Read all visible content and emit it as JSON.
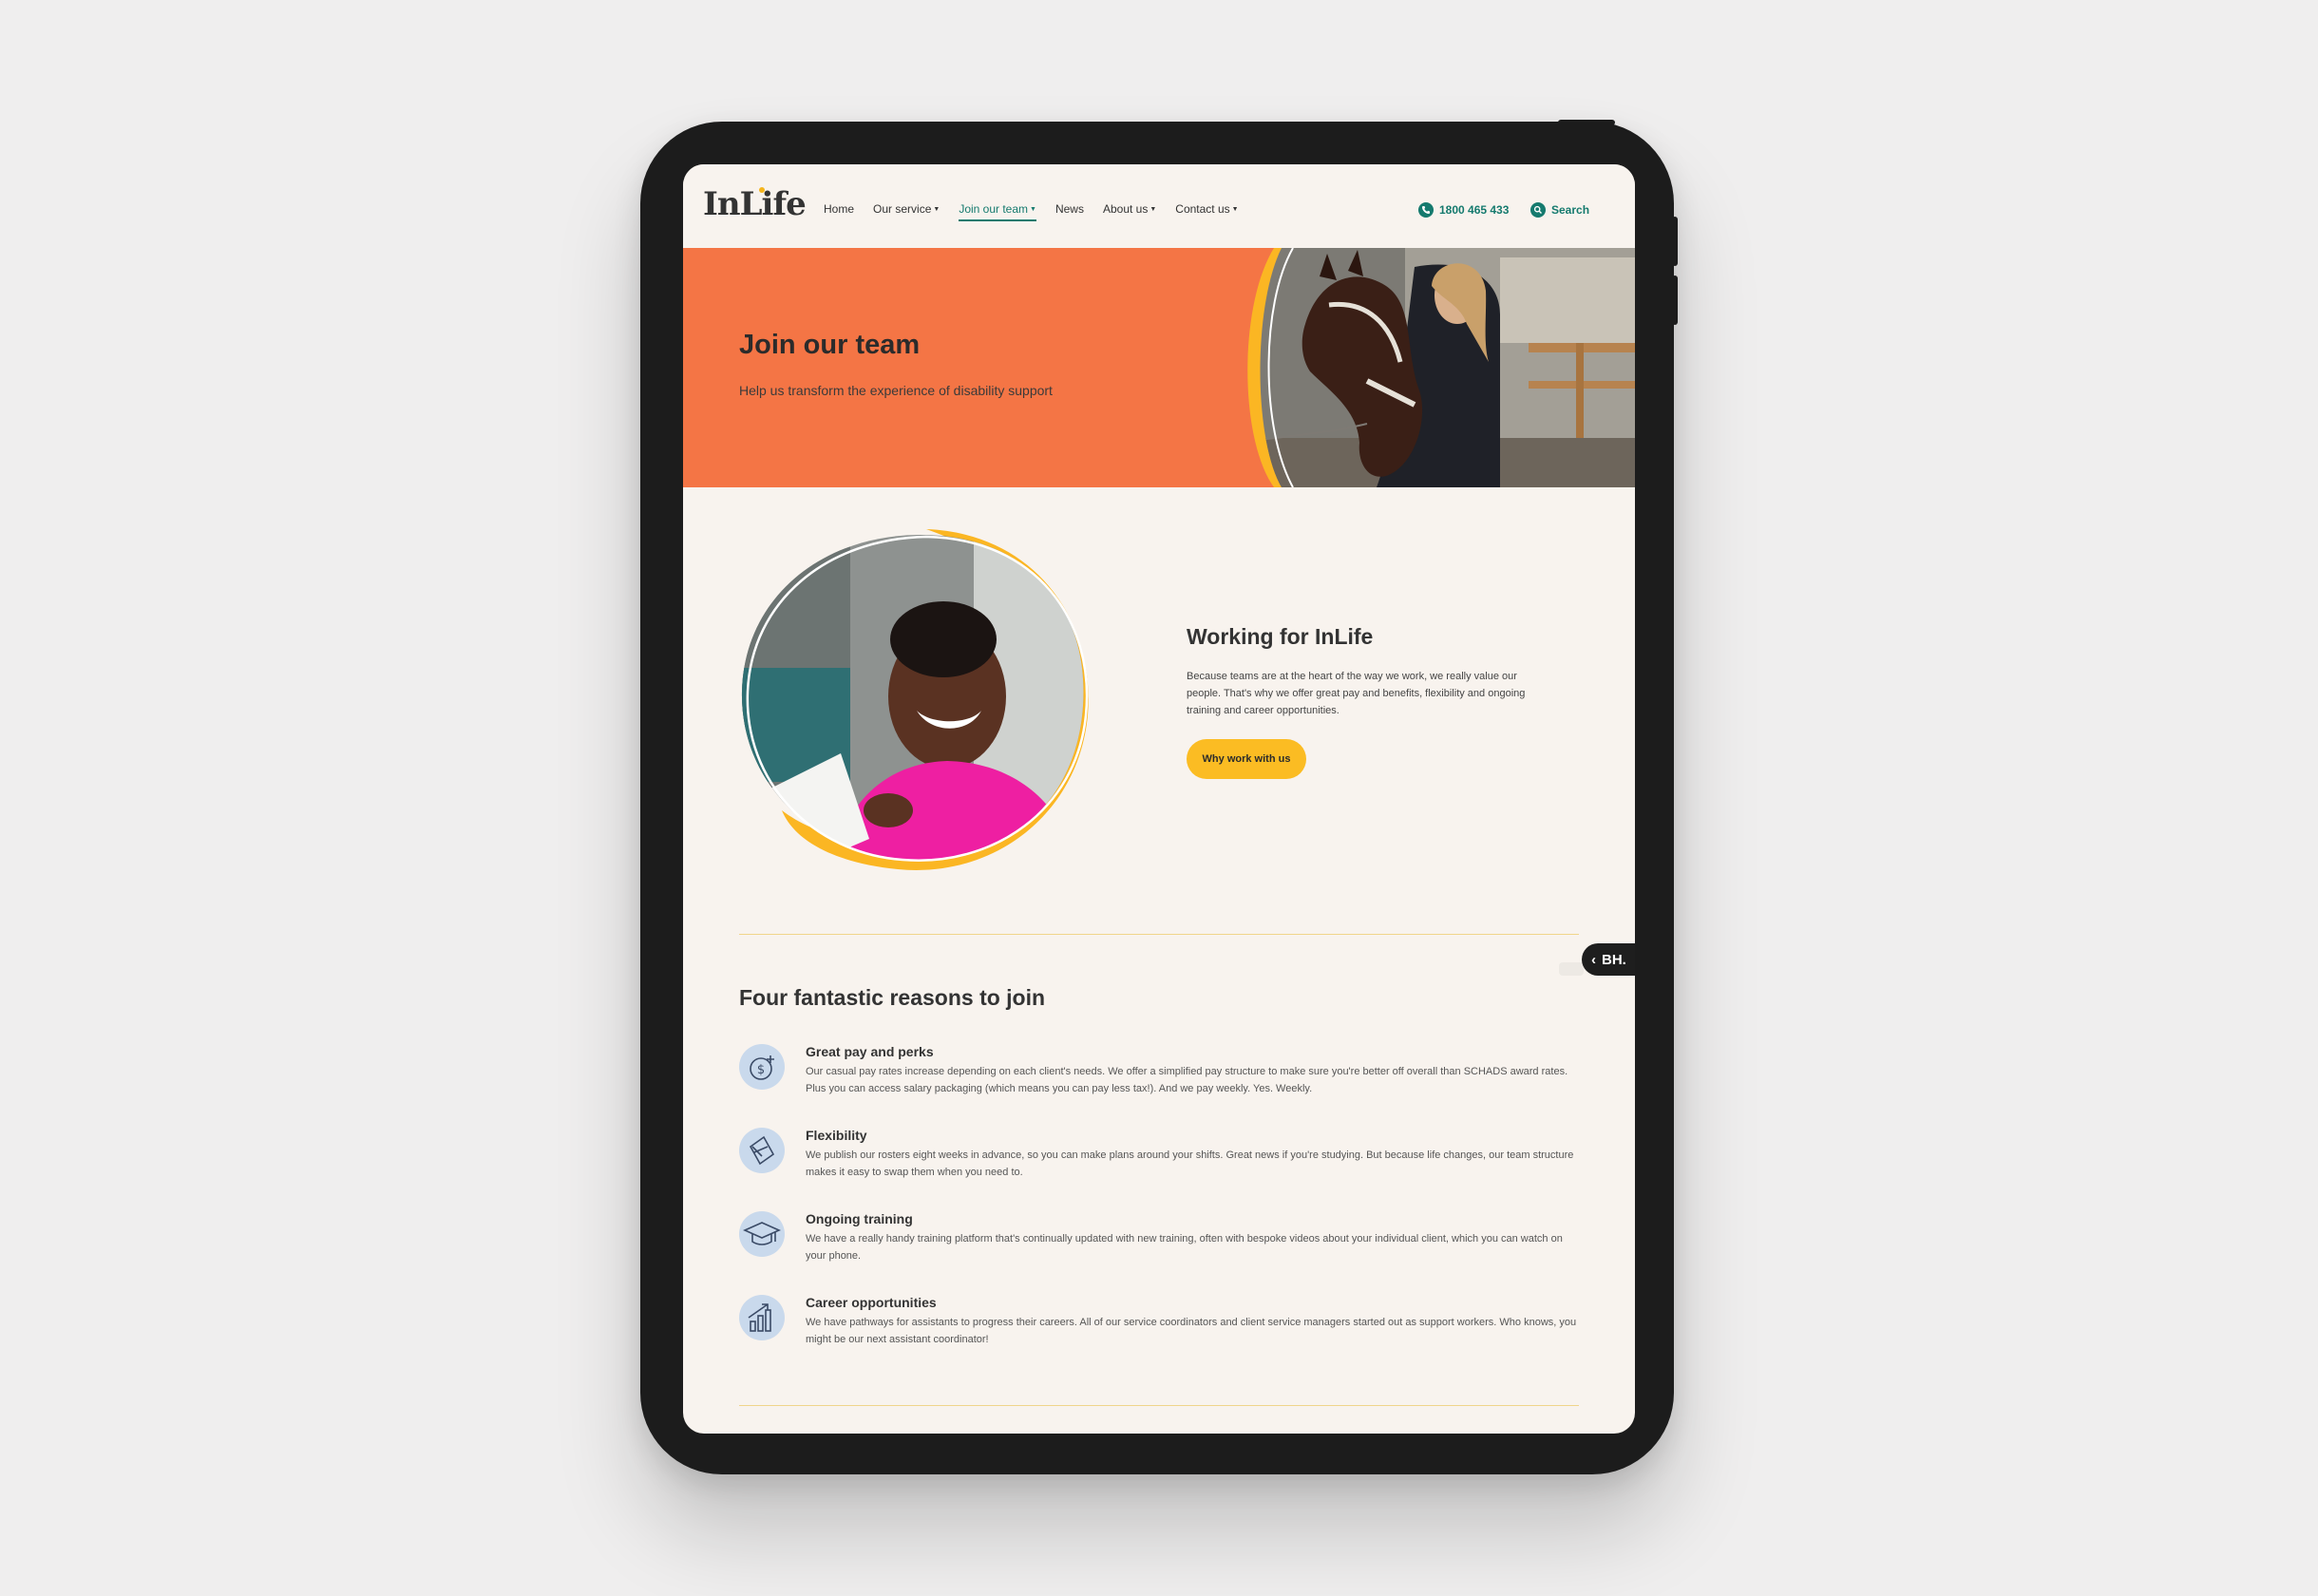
{
  "header": {
    "logo": "InLife",
    "nav": [
      {
        "label": "Home",
        "dropdown": false,
        "active": false
      },
      {
        "label": "Our service",
        "dropdown": true,
        "active": false
      },
      {
        "label": "Join our team",
        "dropdown": true,
        "active": true
      },
      {
        "label": "News",
        "dropdown": false,
        "active": false
      },
      {
        "label": "About us",
        "dropdown": true,
        "active": false
      },
      {
        "label": "Contact us",
        "dropdown": true,
        "active": false
      }
    ],
    "phone": "1800 465 433",
    "search": "Search"
  },
  "hero": {
    "title": "Join our team",
    "subtitle": "Help us transform the experience of disability support"
  },
  "working": {
    "title": "Working for InLife",
    "text": "Because teams are at the heart of the way we work, we really value our people. That's why we offer great pay and benefits, flexibility and ongoing training and career opportunities.",
    "button": "Why work with us"
  },
  "side_tab": {
    "label": "BH."
  },
  "reasons": {
    "title": "Four fantastic reasons to join",
    "items": [
      {
        "icon": "money-icon",
        "title": "Great pay and perks",
        "text": "Our casual pay rates increase depending on each client's needs. We offer a simplified pay structure to make sure you're better off overall than SCHADS award rates. Plus you can access salary packaging (which means you can pay less tax!). And we pay weekly. Yes. Weekly."
      },
      {
        "icon": "flexibility-icon",
        "title": "Flexibility",
        "text": "We publish our rosters eight weeks in advance, so you can make plans around your shifts. Great news if you're studying. But because life changes, our team structure makes it easy to swap them when you need to."
      },
      {
        "icon": "graduation-cap-icon",
        "title": "Ongoing training",
        "text": "We have a really handy training platform that's continually updated with new training, often with bespoke videos about your individual client, which you can watch on your phone."
      },
      {
        "icon": "growth-chart-icon",
        "title": "Career opportunities",
        "text": "We have pathways for assistants to progress their careers. All of our service coordinators and client service managers started out as support workers. Who knows, you might be our next assistant coordinator!"
      }
    ]
  },
  "colors": {
    "accent": "#157a6e",
    "hero_bg": "#f47545",
    "button": "#fbbc23",
    "page_bg": "#f8f3ee",
    "device": "#1c1c1c"
  }
}
